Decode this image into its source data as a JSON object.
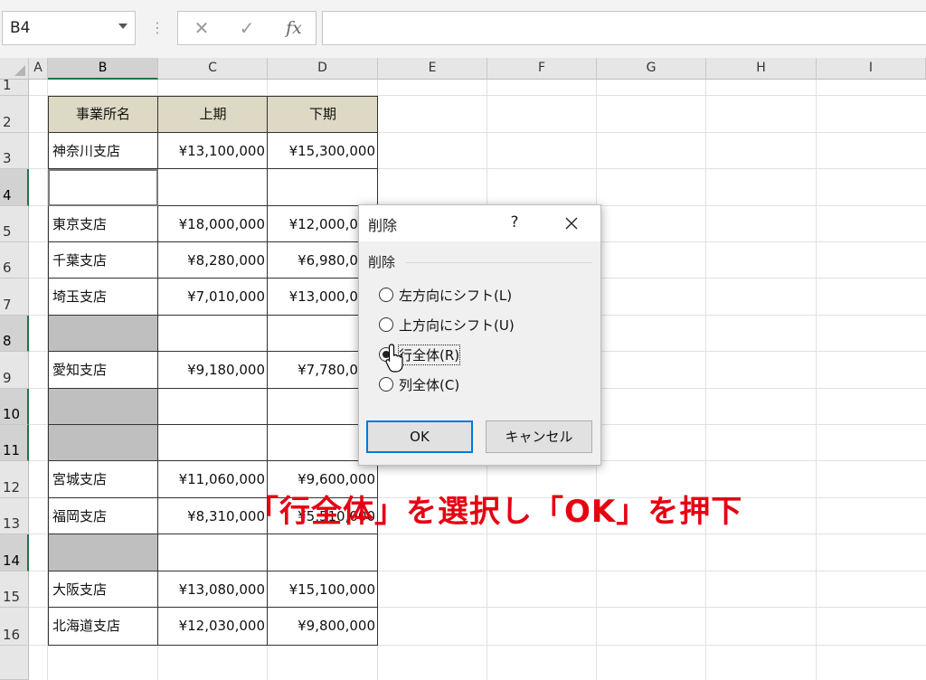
{
  "formula_bar": {
    "name_box": "B4",
    "cancel_icon": "✕",
    "enter_icon": "✓",
    "fx_label": "fx",
    "formula": ""
  },
  "columns": [
    "A",
    "B",
    "C",
    "D",
    "E",
    "F",
    "G",
    "H",
    "I"
  ],
  "rows": [
    "1",
    "2",
    "3",
    "4",
    "5",
    "6",
    "7",
    "8",
    "9",
    "10",
    "11",
    "12",
    "13",
    "14",
    "15",
    "16"
  ],
  "table": {
    "headers": [
      "事業所名",
      "上期",
      "下期"
    ],
    "rows": [
      {
        "name": "神奈川支店",
        "first": "¥13,100,000",
        "second": "¥15,300,000"
      },
      {
        "name": "",
        "first": "",
        "second": ""
      },
      {
        "name": "東京支店",
        "first": "¥18,000,000",
        "second": "¥12,000,000"
      },
      {
        "name": "千葉支店",
        "first": "¥8,280,000",
        "second": "¥6,980,000"
      },
      {
        "name": "埼玉支店",
        "first": "¥7,010,000",
        "second": "¥13,000,000"
      },
      {
        "name": "",
        "first": "",
        "second": ""
      },
      {
        "name": "愛知支店",
        "first": "¥9,180,000",
        "second": "¥7,780,000"
      },
      {
        "name": "",
        "first": "",
        "second": ""
      },
      {
        "name": "",
        "first": "",
        "second": ""
      },
      {
        "name": "宮城支店",
        "first": "¥11,060,000",
        "second": "¥9,600,000"
      },
      {
        "name": "福岡支店",
        "first": "¥8,310,000",
        "second": "¥5,510,000"
      },
      {
        "name": "",
        "first": "",
        "second": ""
      },
      {
        "name": "大阪支店",
        "first": "¥13,080,000",
        "second": "¥15,100,000"
      },
      {
        "name": "北海道支店",
        "first": "¥12,030,000",
        "second": "¥9,800,000"
      }
    ]
  },
  "dialog": {
    "title": "削除",
    "help": "?",
    "group_label": "削除",
    "options": [
      "左方向にシフト(L)",
      "上方向にシフト(U)",
      "行全体(R)",
      "列全体(C)"
    ],
    "selected_option": "行全体(R)",
    "ok": "OK",
    "cancel": "キャンセル"
  },
  "annotation": "「行全体」を選択し「OK」を押下",
  "colors": {
    "header_fill": "#ddd9c4",
    "gray_fill": "#bfbfbf",
    "selection": "#217346",
    "annotation": "#e60012",
    "ok_border": "#0078d7"
  }
}
